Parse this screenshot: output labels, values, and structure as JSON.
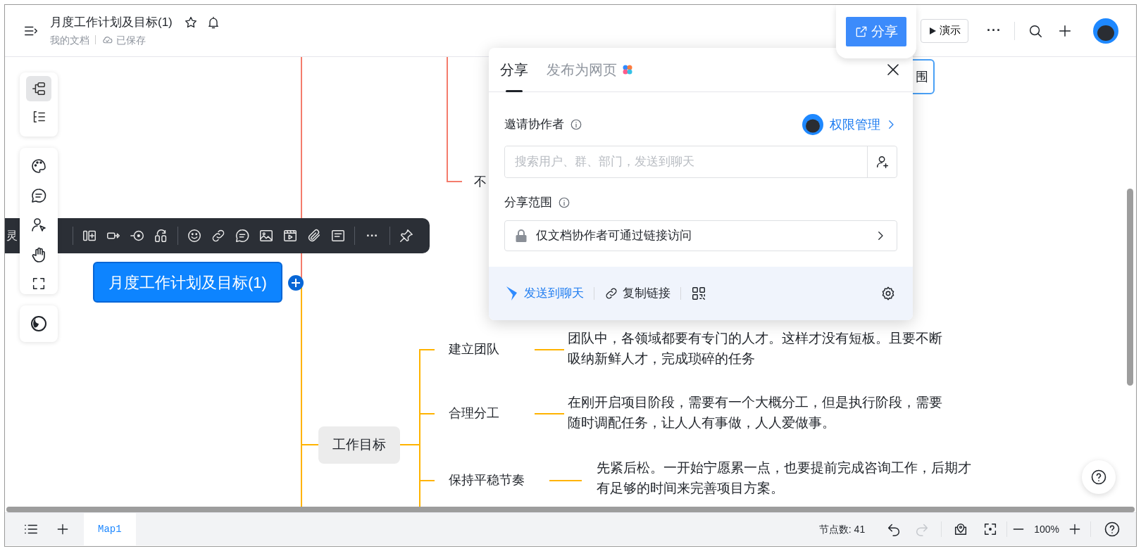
{
  "document": {
    "title": "月度工作计划及目标(1)",
    "starred": false,
    "location": "我的文档",
    "save_status": "已保存"
  },
  "header_actions": {
    "share": "分享",
    "present": "演示",
    "more": "···"
  },
  "left_toolbar": {
    "views": [
      {
        "kind": "mindmap",
        "selected": true
      },
      {
        "kind": "outline",
        "selected": false
      }
    ]
  },
  "node_toolbar": {
    "cut_label": "灵",
    "more": "···"
  },
  "mindmap": {
    "root": "月度工作计划及目标(1)",
    "partial_nodes": [
      {
        "kind": "plain",
        "label": "不"
      },
      {
        "kind": "boxed",
        "label": "围"
      }
    ],
    "branch": {
      "label": "工作目标",
      "children": [
        {
          "label": "建立团队",
          "note": "团队中，各领域都要有专门的人才。这样才没有短板。且要不断吸纳新鲜人才，完成琐碎的任务"
        },
        {
          "label": "合理分工",
          "note": "在刚开启项目阶段，需要有一个大概分工，但是执行阶段，需要随时调配任务，让人人有事做，人人爱做事。"
        },
        {
          "label": "保持平稳节奏",
          "note": "先紧后松。一开始宁愿累一点，也要提前完成咨询工作，后期才有足够的时间来完善项目方案。"
        }
      ]
    }
  },
  "share_dialog": {
    "tabs": [
      {
        "label": "分享",
        "selected": true
      },
      {
        "label": "发布为网页",
        "selected": false
      }
    ],
    "invite_label": "邀请协作者",
    "permission_link": "权限管理",
    "search": {
      "placeholder": "搜索用户、群、部门，发送到聊天"
    },
    "scope_label": "分享范围",
    "scope": "仅文档协作者可通过链接访问",
    "actions": [
      {
        "kind": "send",
        "label": "发送到聊天"
      },
      {
        "kind": "copy",
        "label": "复制链接"
      },
      {
        "kind": "qr"
      }
    ]
  },
  "bottom_bar": {
    "sheets": [
      {
        "label": "Map1",
        "selected": true
      }
    ],
    "node_count": "节点数: 41",
    "redo_disabled": true,
    "zoom": "100%"
  }
}
